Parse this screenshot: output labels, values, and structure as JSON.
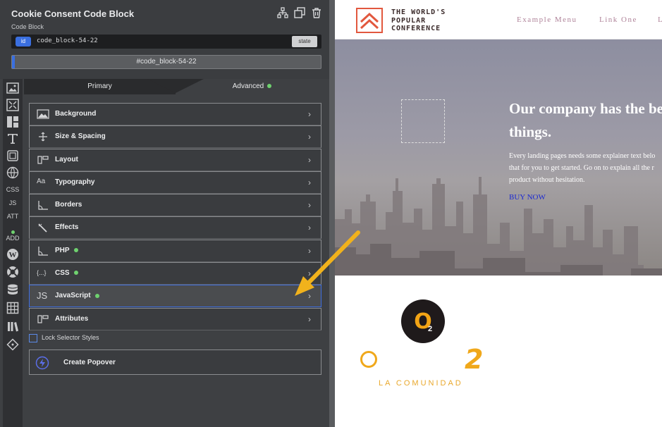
{
  "panel": {
    "title": "Cookie Consent Code Block",
    "subtitle": "Code Block",
    "id_badge": "id",
    "id_value": "code_block-54-22",
    "state_label": "state",
    "selector": "#code_block-54-22",
    "tabs": {
      "primary": "Primary",
      "advanced": "Advanced"
    },
    "rail": {
      "css": "CSS",
      "js": "JS",
      "att": "ATT",
      "add": "ADD"
    },
    "rows": [
      {
        "label": "Background",
        "icon": "background-icon"
      },
      {
        "label": "Size & Spacing",
        "icon": "size-spacing-icon"
      },
      {
        "label": "Layout",
        "icon": "layout-icon"
      },
      {
        "label": "Typography",
        "icon": "typography-icon",
        "icon_text": "Aa"
      },
      {
        "label": "Borders",
        "icon": "borders-icon"
      },
      {
        "label": "Effects",
        "icon": "effects-icon"
      },
      {
        "label": "PHP",
        "icon": "php-icon",
        "dot": true
      },
      {
        "label": "CSS",
        "icon": "css-icon",
        "dot": true,
        "icon_text": "{...}"
      },
      {
        "label": "JavaScript",
        "icon": "javascript-icon",
        "dot": true,
        "icon_text": "JS"
      },
      {
        "label": "Attributes",
        "icon": "attributes-icon"
      }
    ],
    "lock_label": "Lock Selector Styles",
    "popover_label": "Create Popover"
  },
  "preview": {
    "logo_lines": [
      "THE WORLD'S",
      "POPULAR",
      "CONFERENCE"
    ],
    "nav": [
      "Example Menu",
      "Link One",
      "L"
    ],
    "hero_heading_lines": [
      "Our company has the be",
      "things."
    ],
    "hero_text_lines": [
      "Every landing pages needs some explainer text belo",
      "that for you to get started. Go on to explain all the r",
      "product without hesitation."
    ],
    "buy_now": "BUY NOW",
    "o2_mark": "O",
    "o2_sub": "2",
    "brand_digit": "2",
    "brand_sub": "LA COMUNIDAD"
  },
  "colors": {
    "accent_blue": "#3a6fe0",
    "status_green": "#6fd26f",
    "arrow": "#f1b21c",
    "logo_red": "#e2583e",
    "brand_orange": "#f0a81b"
  }
}
